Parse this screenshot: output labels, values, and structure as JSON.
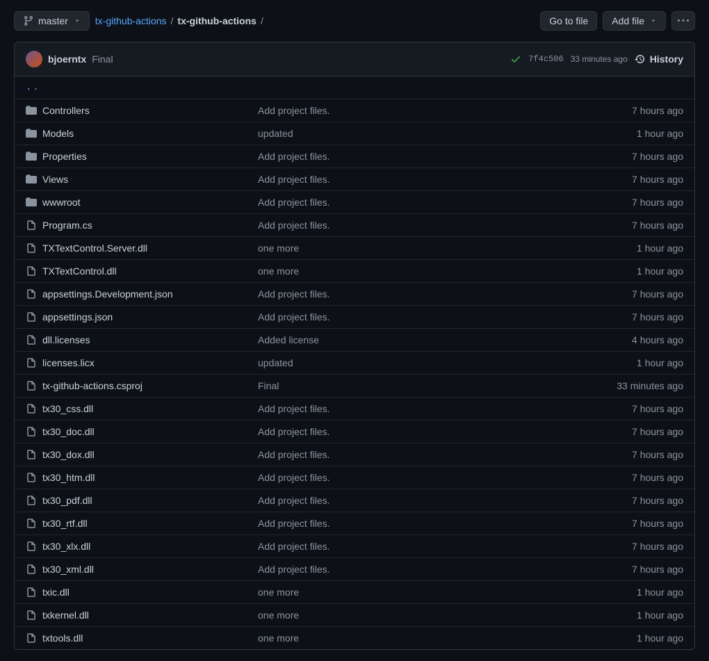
{
  "branch": {
    "label": "master"
  },
  "breadcrumb": {
    "repo": "tx-github-actions",
    "path": "tx-github-actions"
  },
  "buttons": {
    "goToFile": "Go to file",
    "addFile": "Add file"
  },
  "commit": {
    "author": "bjoerntx",
    "message": "Final",
    "sha": "7f4c506",
    "time": "33 minutes ago",
    "historyLabel": "History"
  },
  "parentLink": "..",
  "files": [
    {
      "type": "dir",
      "name": "Controllers",
      "msg": "Add project files.",
      "time": "7 hours ago"
    },
    {
      "type": "dir",
      "name": "Models",
      "msg": "updated",
      "time": "1 hour ago"
    },
    {
      "type": "dir",
      "name": "Properties",
      "msg": "Add project files.",
      "time": "7 hours ago"
    },
    {
      "type": "dir",
      "name": "Views",
      "msg": "Add project files.",
      "time": "7 hours ago"
    },
    {
      "type": "dir",
      "name": "wwwroot",
      "msg": "Add project files.",
      "time": "7 hours ago"
    },
    {
      "type": "file",
      "name": "Program.cs",
      "msg": "Add project files.",
      "time": "7 hours ago"
    },
    {
      "type": "file",
      "name": "TXTextControl.Server.dll",
      "msg": "one more",
      "time": "1 hour ago"
    },
    {
      "type": "file",
      "name": "TXTextControl.dll",
      "msg": "one more",
      "time": "1 hour ago"
    },
    {
      "type": "file",
      "name": "appsettings.Development.json",
      "msg": "Add project files.",
      "time": "7 hours ago"
    },
    {
      "type": "file",
      "name": "appsettings.json",
      "msg": "Add project files.",
      "time": "7 hours ago"
    },
    {
      "type": "file",
      "name": "dll.licenses",
      "msg": "Added license",
      "time": "4 hours ago"
    },
    {
      "type": "file",
      "name": "licenses.licx",
      "msg": "updated",
      "time": "1 hour ago"
    },
    {
      "type": "file",
      "name": "tx-github-actions.csproj",
      "msg": "Final",
      "time": "33 minutes ago"
    },
    {
      "type": "file",
      "name": "tx30_css.dll",
      "msg": "Add project files.",
      "time": "7 hours ago"
    },
    {
      "type": "file",
      "name": "tx30_doc.dll",
      "msg": "Add project files.",
      "time": "7 hours ago"
    },
    {
      "type": "file",
      "name": "tx30_dox.dll",
      "msg": "Add project files.",
      "time": "7 hours ago"
    },
    {
      "type": "file",
      "name": "tx30_htm.dll",
      "msg": "Add project files.",
      "time": "7 hours ago"
    },
    {
      "type": "file",
      "name": "tx30_pdf.dll",
      "msg": "Add project files.",
      "time": "7 hours ago"
    },
    {
      "type": "file",
      "name": "tx30_rtf.dll",
      "msg": "Add project files.",
      "time": "7 hours ago"
    },
    {
      "type": "file",
      "name": "tx30_xlx.dll",
      "msg": "Add project files.",
      "time": "7 hours ago"
    },
    {
      "type": "file",
      "name": "tx30_xml.dll",
      "msg": "Add project files.",
      "time": "7 hours ago"
    },
    {
      "type": "file",
      "name": "txic.dll",
      "msg": "one more",
      "time": "1 hour ago"
    },
    {
      "type": "file",
      "name": "txkernel.dll",
      "msg": "one more",
      "time": "1 hour ago"
    },
    {
      "type": "file",
      "name": "txtools.dll",
      "msg": "one more",
      "time": "1 hour ago"
    }
  ]
}
